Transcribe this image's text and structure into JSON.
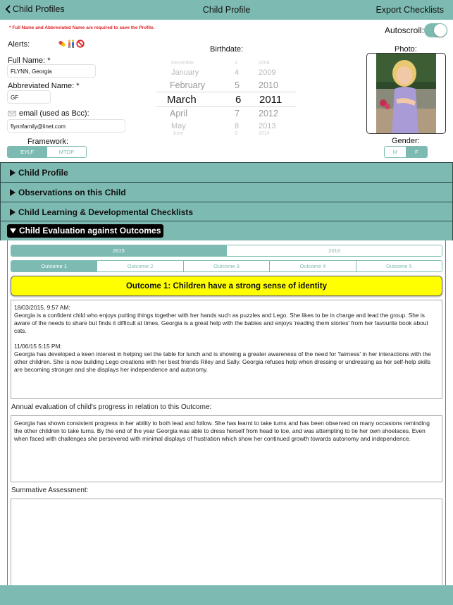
{
  "navbar": {
    "back_label": "Child Profiles",
    "title": "Child Profile",
    "export_label": "Export Checklists"
  },
  "form": {
    "required_note": "* Full Name and Abbreviated Name are required to save the Profile.",
    "autoscroll_label": "Autoscroll:",
    "autoscroll_on": true,
    "alerts_label": "Alerts:",
    "alert_icons": [
      "pill-icon",
      "children-icon",
      "prohibited-icon"
    ],
    "full_name_label": "Full Name: *",
    "full_name_value": "FLYNN, Georgia",
    "abbrev_label": "Abbreviated Name: *",
    "abbrev_value": "GF",
    "email_label": "email (used as Bcc):",
    "email_value": "flynnfamily@iinet.com",
    "framework_label": "Framework:",
    "framework_options": [
      "EYLF",
      "MTOP"
    ],
    "framework_selected": "EYLF",
    "birthdate_label": "Birthdate:",
    "birthdate_picker": {
      "months": [
        "December",
        "January",
        "February",
        "March",
        "April",
        "May",
        "June"
      ],
      "days": [
        "3",
        "4",
        "5",
        "6",
        "7",
        "8",
        "9"
      ],
      "years": [
        "2008",
        "2009",
        "2010",
        "2011",
        "2012",
        "2013",
        "2014"
      ],
      "selected": {
        "month": "March",
        "day": "6",
        "year": "2011"
      }
    },
    "photo_label": "Photo:",
    "gender_label": "Gender:",
    "gender_options": [
      "M",
      "F"
    ],
    "gender_selected": "F"
  },
  "sections": [
    {
      "label": "Child Profile",
      "open": false
    },
    {
      "label": "Observations on this Child",
      "open": false
    },
    {
      "label": "Child Learning & Developmental Checklists",
      "open": false
    },
    {
      "label": "Child Evaluation against Outcomes",
      "open": true
    }
  ],
  "evaluation": {
    "years": [
      "2015",
      "2016"
    ],
    "year_selected": "2015",
    "outcomes": [
      "Outcome 1",
      "Outcome 2",
      "Outcome 3",
      "Outcome 4",
      "Outcome 5"
    ],
    "outcome_selected": "Outcome 1",
    "outcome_title": "Outcome 1: Children have a strong sense of identity",
    "observations": [
      {
        "timestamp": "18/03/2015, 9:57 AM:",
        "text": "Georgia is a confident child who enjoys putting things together with her hands such as puzzles and Lego. She likes to be in charge and lead the group. She is aware of the needs to share but finds it difficult at times. Georgia is a great help with the babies and enjoys 'reading them stories' from her favourite book about cats."
      },
      {
        "timestamp": "11/06/15 5:15 PM:",
        "text": "Georgia has developed a keen interest in helping set the table for lunch and is showing a greater awareness of the need for 'fairness' in her interactions with the other children. She is now building Lego creations with her best friends Riley and Sally. Georgia refuses help when dressing or undressing as her self-help skills are becoming stronger and she displays her independence and autonomy."
      }
    ],
    "annual_label": "Annual evaluation of child's progress in relation to this Outcome:",
    "annual_text": "Georgia has shown consistent progress in her ability to both lead and follow. She has learnt to take turns and has been observed on many occasions reminding the other children to take turns. By the end of the year Georgia was able to dress herself from head to toe, and was attempting to tie her own shoelaces. Even when faced with challenges she persevered with minimal displays of frustration which show her continued growth towards autonomy and independence.",
    "summative_label": "Summative Assessment:",
    "summative_text": ""
  },
  "colors": {
    "accent": "#7dbbb2",
    "required": "#e0222a",
    "outcome_banner": "#ffff00"
  }
}
